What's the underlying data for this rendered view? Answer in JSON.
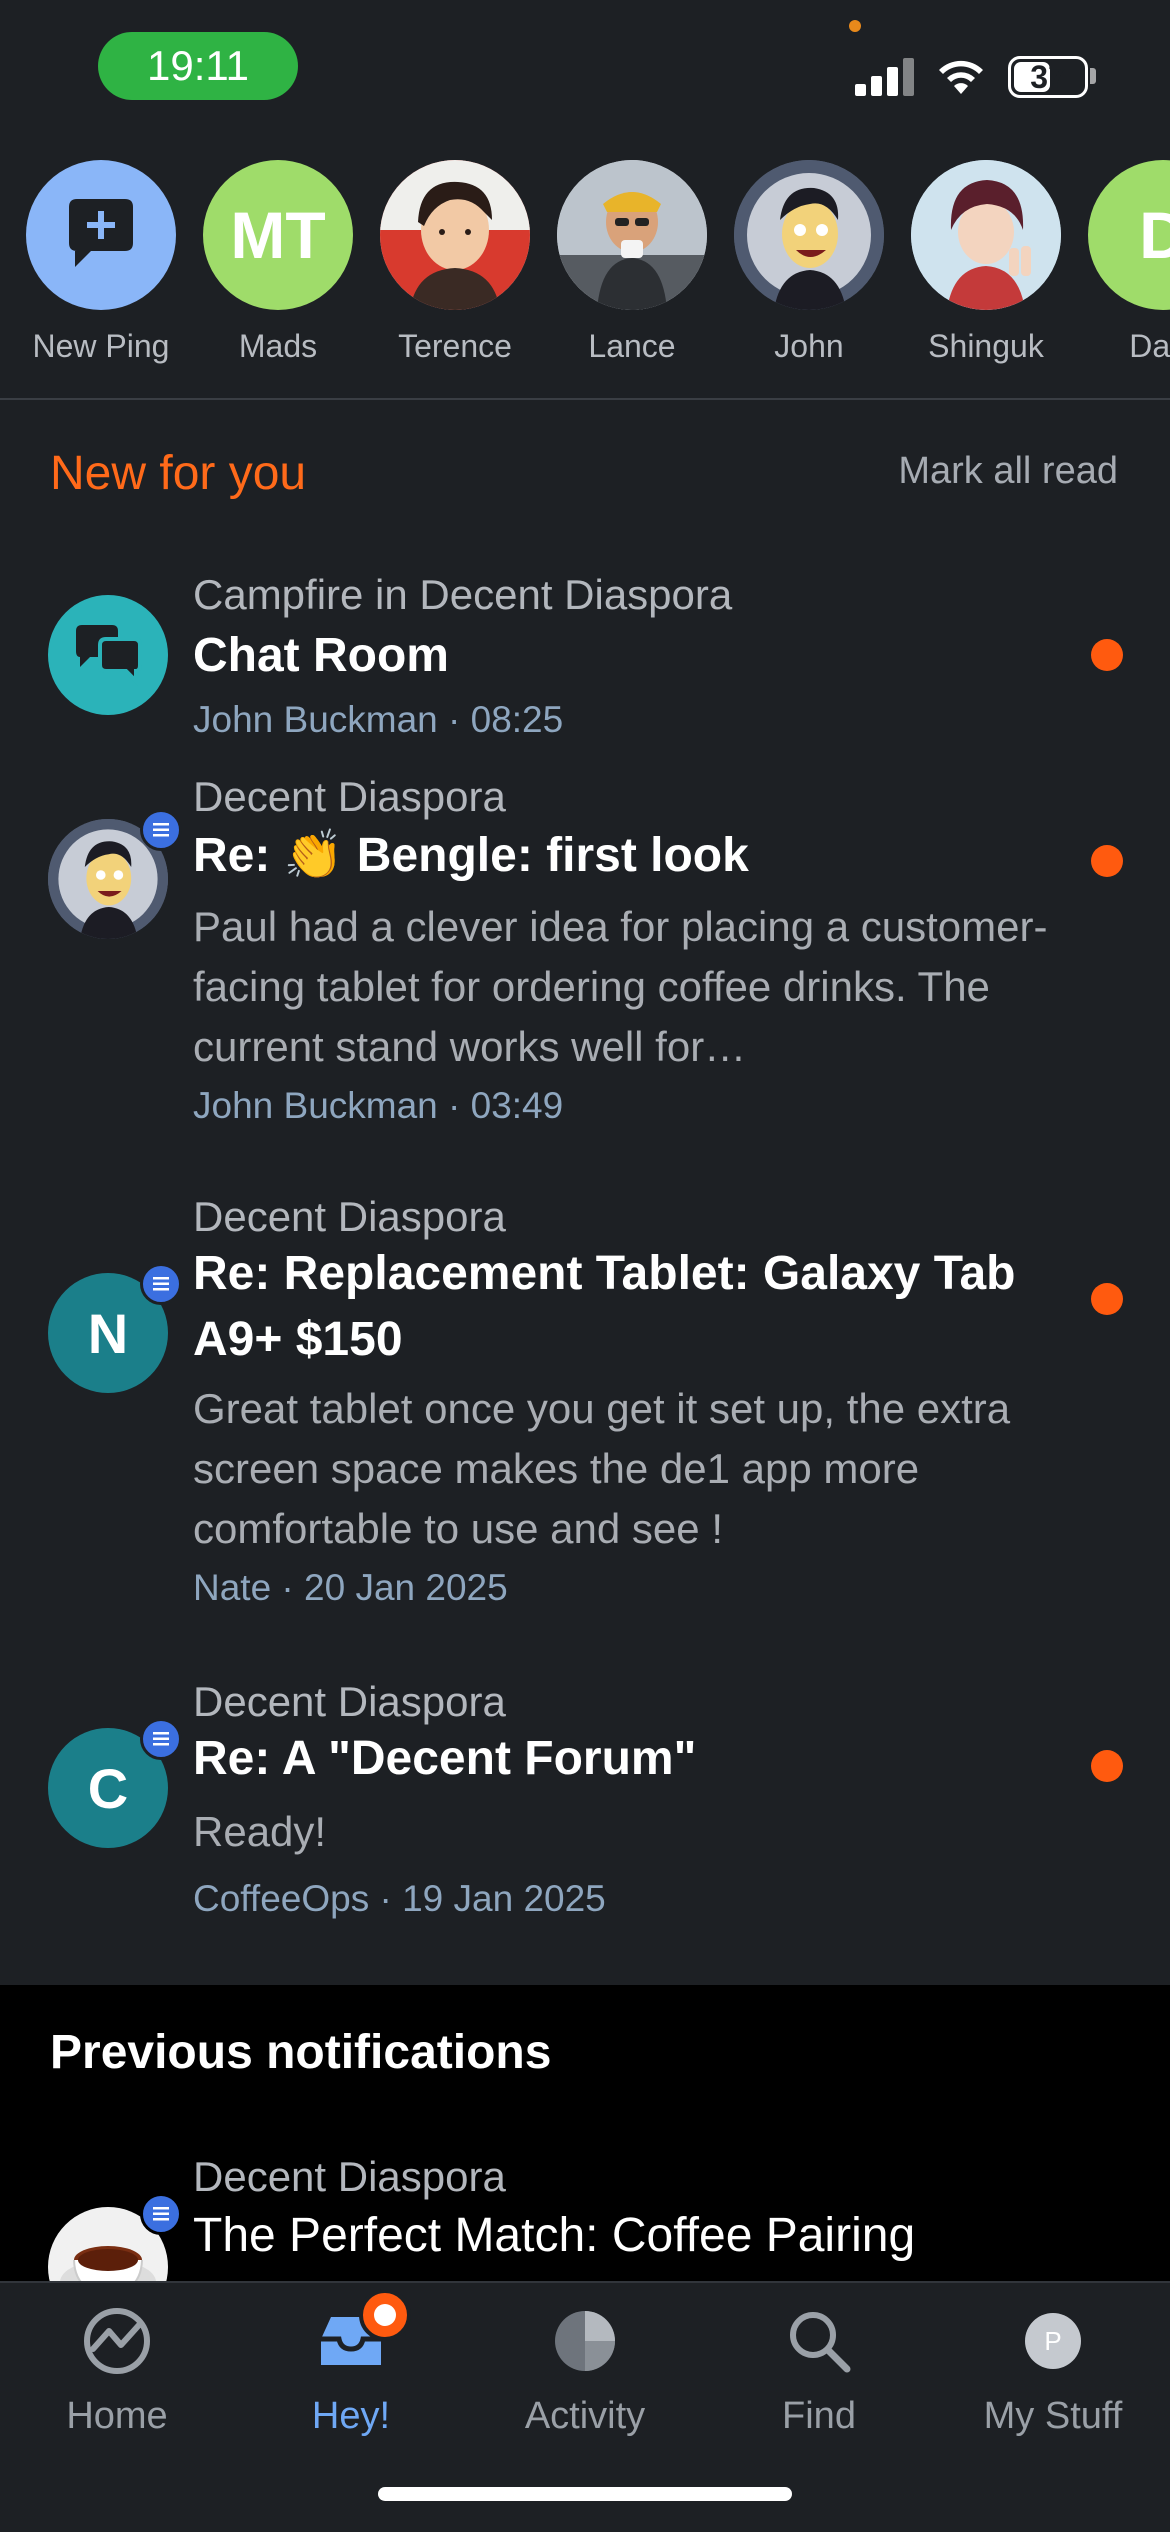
{
  "status_bar": {
    "time": "19:11",
    "battery": "37"
  },
  "people": [
    {
      "name": "New Ping",
      "kind": "new-ping",
      "color": "#8ab6f8"
    },
    {
      "name": "Mads",
      "initials": "MT",
      "color": "#9fdc6a"
    },
    {
      "name": "Terence",
      "color": "#d83a2e"
    },
    {
      "name": "Lance",
      "color": "#c9cfd6"
    },
    {
      "name": "John",
      "color": "#5a6478"
    },
    {
      "name": "Shinguk",
      "color": "#b9d6e8"
    },
    {
      "name": "Dam",
      "initials": "D",
      "color": "#9fdc6a"
    }
  ],
  "new_section": {
    "title": "New for you",
    "mark_all_read": "Mark all read"
  },
  "items": [
    {
      "context": "Campfire in Decent Diaspora",
      "title": "Chat Room",
      "excerpt": "",
      "meta": "John Buckman · 08:25",
      "avatar": "chat",
      "unread": true
    },
    {
      "context": "Decent Diaspora",
      "title": "Re: 👏 Bengle: first look",
      "excerpt": "Paul had a clever idea for placing a customer-facing tablet for ordering coffee drinks.  The current stand works well for…",
      "meta": "John Buckman · 03:49",
      "avatar": "john",
      "unread": true
    },
    {
      "context": "Decent Diaspora",
      "title": "Re: Replacement Tablet: Galaxy Tab A9+ $150",
      "excerpt": "Great tablet once you get it set up, the extra screen space makes the de1 app more comfortable to use and see !",
      "meta": "Nate · 20 Jan 2025",
      "avatar": "N",
      "unread": true
    },
    {
      "context": "Decent Diaspora",
      "title": "Re: A \"Decent Forum\"",
      "excerpt": "Ready!",
      "meta": "CoffeeOps · 19 Jan 2025",
      "avatar": "C",
      "unread": true
    }
  ],
  "previous_section": {
    "title": "Previous notifications",
    "item": {
      "context": "Decent Diaspora",
      "title": "The Perfect Match: Coffee Pairing"
    }
  },
  "tabs": [
    {
      "label": "Home",
      "icon": "home-icon"
    },
    {
      "label": "Hey!",
      "icon": "inbox-icon",
      "active": true
    },
    {
      "label": "Activity",
      "icon": "activity-pie-icon"
    },
    {
      "label": "Find",
      "icon": "search-icon"
    },
    {
      "label": "My Stuff",
      "icon": "profile-icon",
      "initial": "P"
    }
  ],
  "colors": {
    "background": "#1d2024",
    "accent_orange": "#ff6a1a",
    "accent_blue": "#6fa8f5",
    "unread_dot": "#ff5a0f",
    "teal_avatar": "#1b7f8a"
  }
}
